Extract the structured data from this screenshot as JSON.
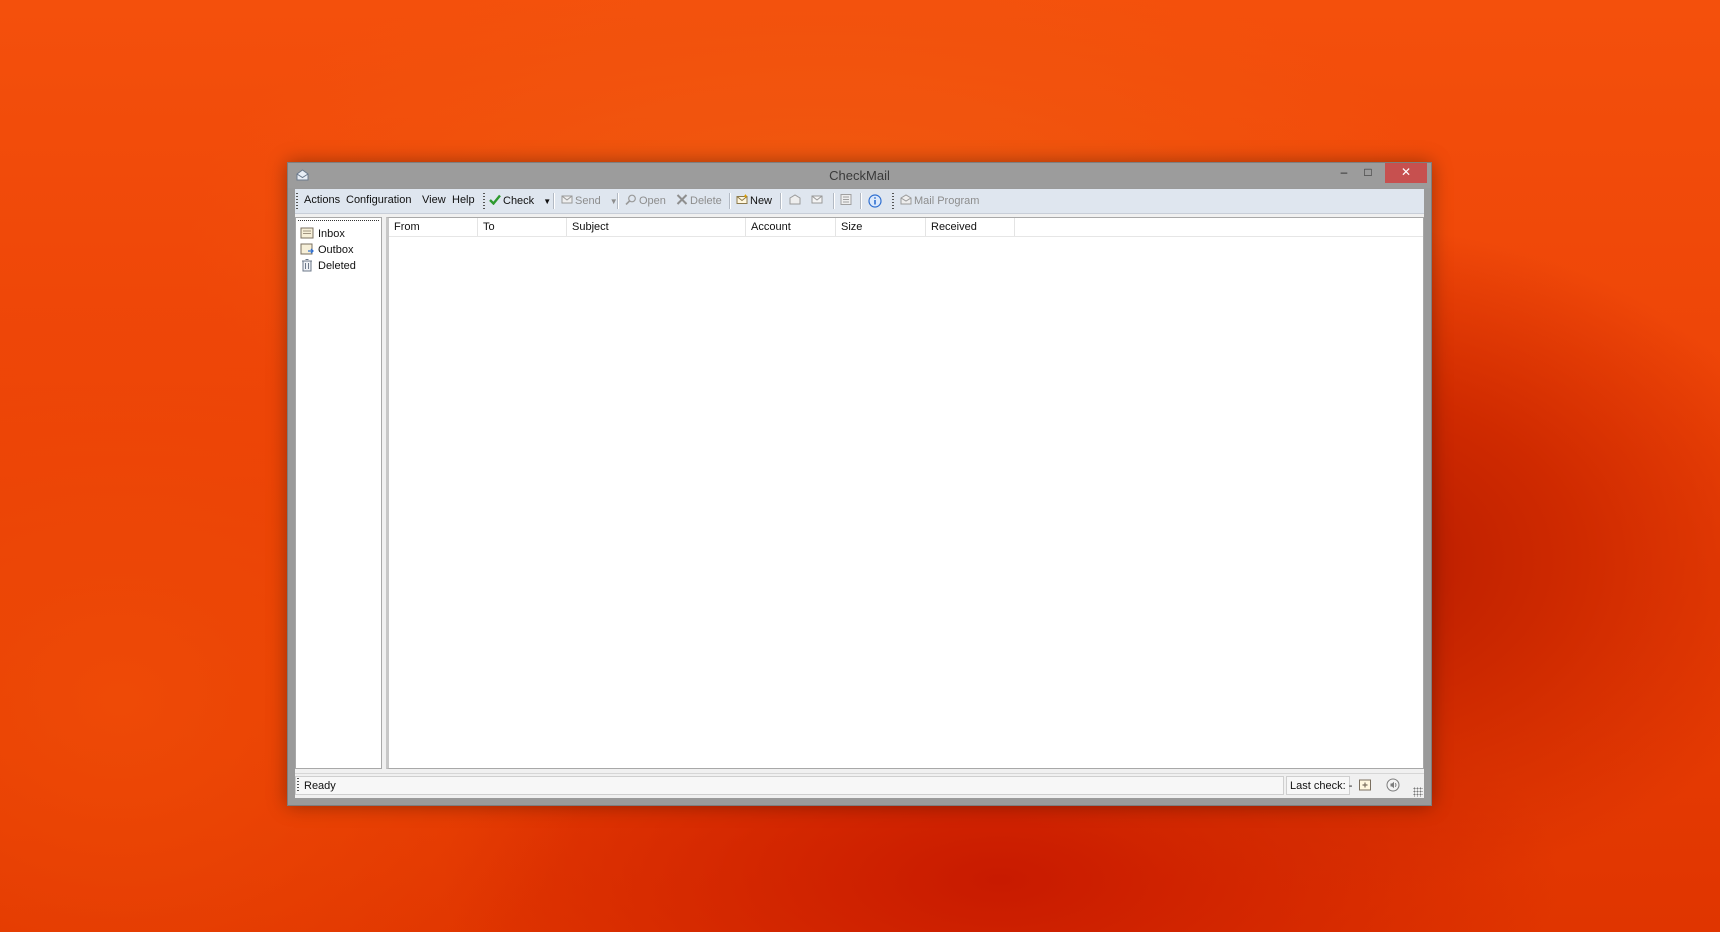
{
  "window": {
    "title": "CheckMail"
  },
  "menu": {
    "items": [
      "Actions",
      "Configuration",
      "View",
      "Help"
    ]
  },
  "toolbar": {
    "check_label": "Check",
    "send_label": "Send",
    "open_label": "Open",
    "delete_label": "Delete",
    "new_label": "New",
    "mail_program_label": "Mail Program",
    "dropdown_arrow": "▼"
  },
  "folders": {
    "items": [
      "Inbox",
      "Outbox",
      "Deleted"
    ]
  },
  "message_list": {
    "columns": [
      "From",
      "To",
      "Subject",
      "Account",
      "Size",
      "Received"
    ]
  },
  "status": {
    "text": "Ready",
    "last_check": "Last check: -"
  },
  "colors": {
    "accent_close": "#c7504f",
    "toolbar_bg": "#dfe6ef",
    "check_green": "#2e9a2e",
    "info_blue": "#2f6fd0"
  },
  "icons": {
    "app": "envelope-icon",
    "check": "checkmark-icon",
    "send": "send-mail-icon",
    "open": "magnifier-icon",
    "delete": "x-icon",
    "new": "new-mail-icon",
    "info": "info-icon"
  }
}
